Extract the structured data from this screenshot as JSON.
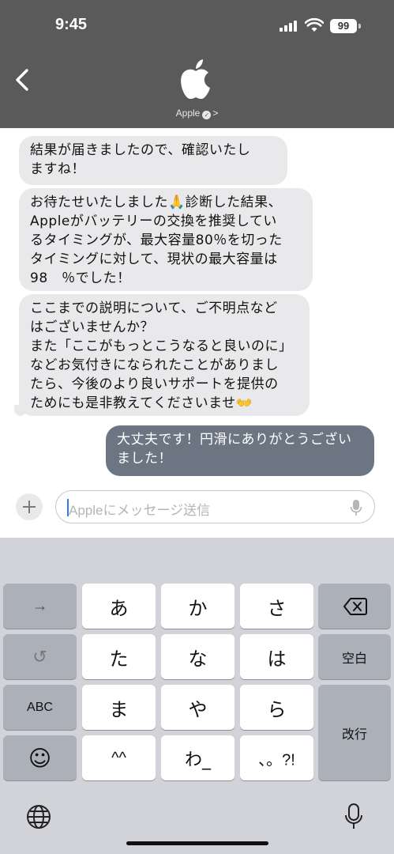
{
  "status_bar": {
    "time": "9:45",
    "battery": "99"
  },
  "header": {
    "contact_name": "Apple",
    "verified_mark": "✓",
    "chevron": ">"
  },
  "messages": [
    {
      "direction": "incoming",
      "text": "結果が届きましたので、確認いたし\nますね！"
    },
    {
      "direction": "incoming",
      "text": "お待たせいたしました🙏診断した結果、\nAppleがバッテリーの交換を推奨してい\nるタイミングが、最大容量80％を切った\nタイミングに対して、現状の最大容量は\n98　％でした！"
    },
    {
      "direction": "incoming",
      "text": "ここまでの説明について、ご不明点など\nはございませんか？\nまた「ここがもっとこうなると良いのに」\nなどお気付きになられたことがありまし\nたら、今後のより良いサポートを提供の\nためにも是非教えてくださいませ👐"
    },
    {
      "direction": "outgoing",
      "text": "大丈夫です！円滑にありがとうござい\nました！"
    }
  ],
  "input": {
    "placeholder": "Appleにメッセージ送信"
  },
  "keyboard": {
    "keys": {
      "arrow": "→",
      "a": "あ",
      "ka": "か",
      "sa": "さ",
      "undo": "↺",
      "ta": "た",
      "na": "な",
      "ha": "は",
      "space": "空白",
      "abc": "ABC",
      "ma": "ま",
      "ya": "や",
      "ra": "ら",
      "enter": "改行",
      "emoji": "☺",
      "dakuten": "^^",
      "wa": "わ_",
      "punct": "、。?!"
    }
  },
  "colors": {
    "header_bg": "#5a5a5a",
    "incoming_bubble": "#e9e9eb",
    "outgoing_bubble": "#6b7682",
    "keyboard_bg": "#d1d3d9",
    "cursor": "#3478f6"
  }
}
